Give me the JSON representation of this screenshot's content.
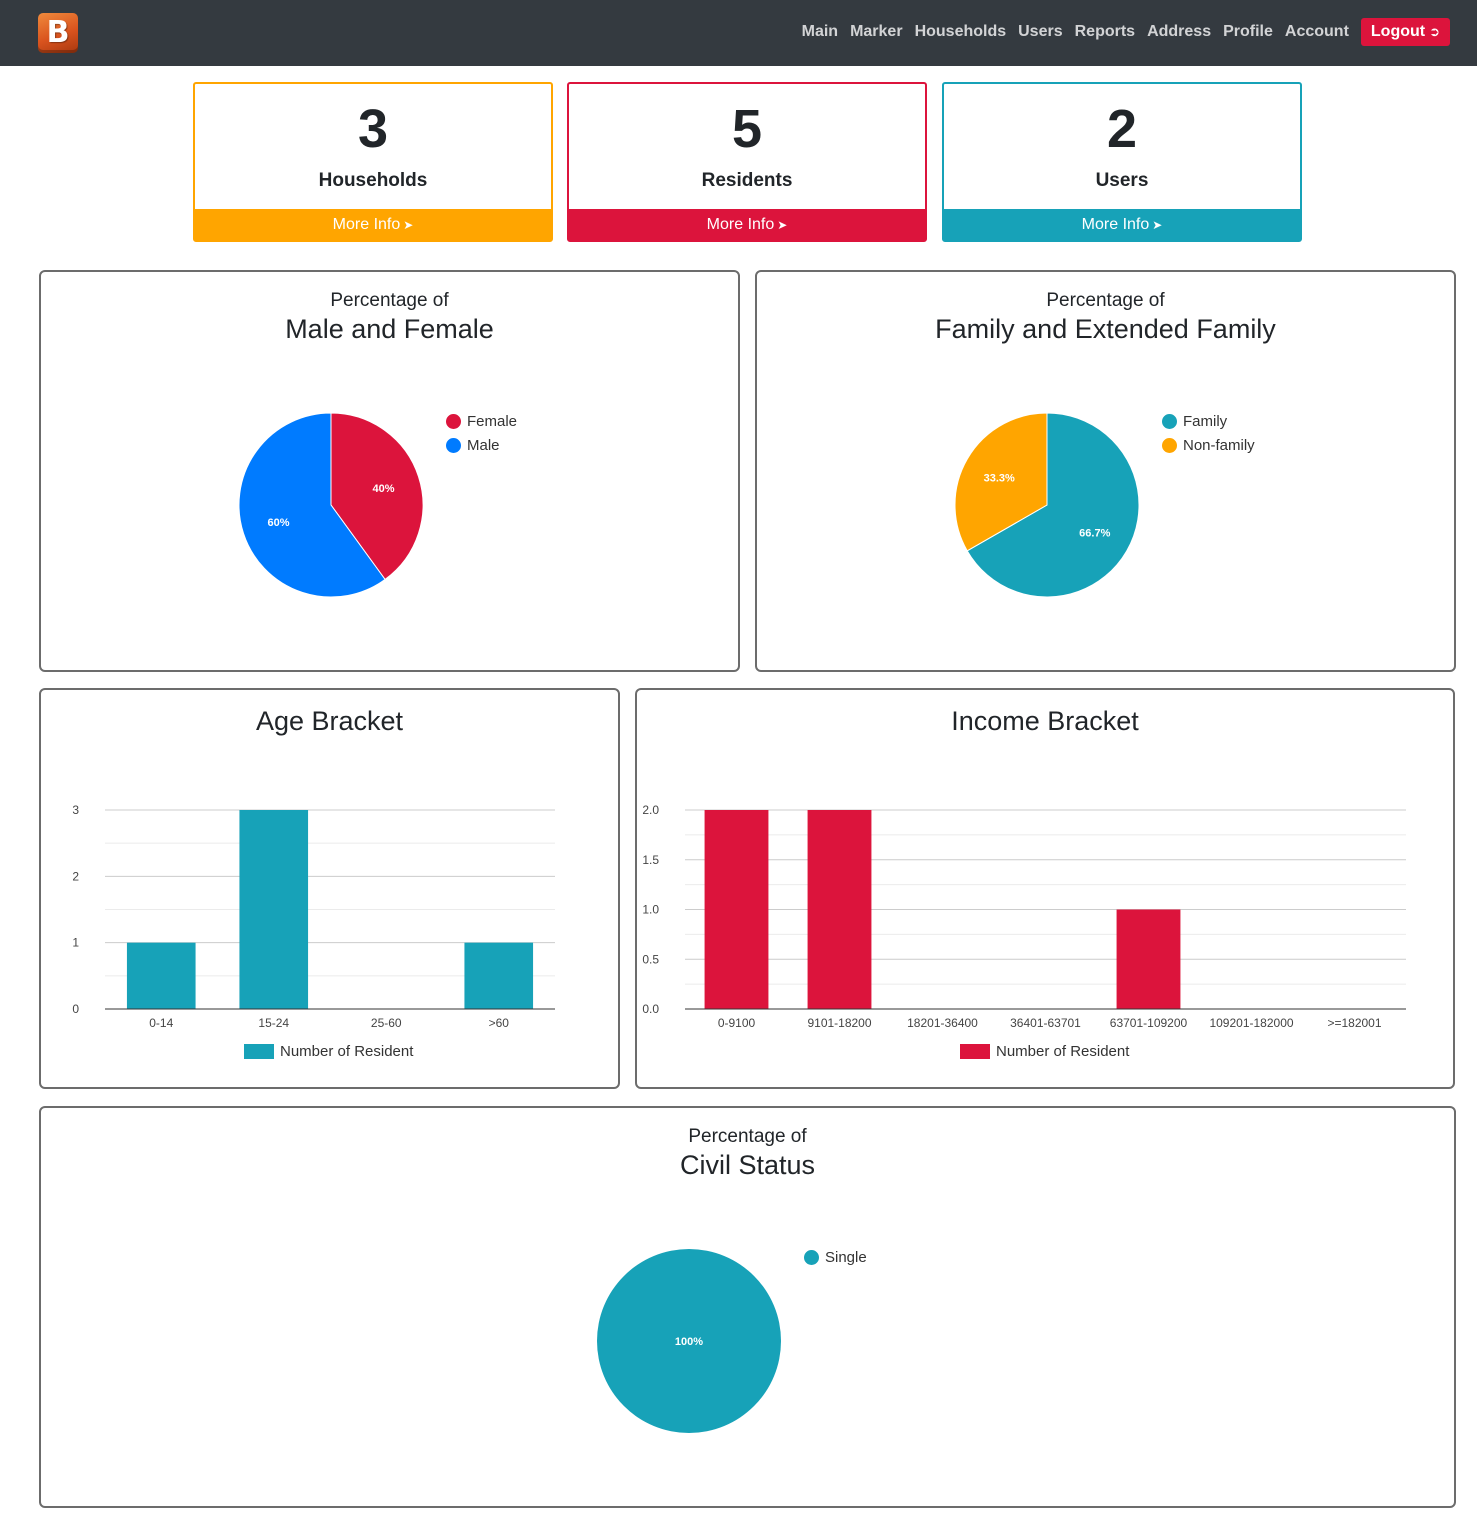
{
  "navbar": {
    "logo_letter": "B",
    "links": [
      "Main",
      "Marker",
      "Households",
      "Users",
      "Reports",
      "Address",
      "Profile",
      "Account"
    ],
    "logout_label": "Logout",
    "logout_icon": "sign-out-icon"
  },
  "stats": [
    {
      "value": "3",
      "label": "Households",
      "more": "More Info",
      "color": "#ffa500"
    },
    {
      "value": "5",
      "label": "Residents",
      "more": "More Info",
      "color": "#dc143c"
    },
    {
      "value": "2",
      "label": "Users",
      "more": "More Info",
      "color": "#17a2b8"
    }
  ],
  "more_info_icon": "sign-in-icon",
  "panels": {
    "gender": {
      "subtitle": "Percentage of",
      "title": "Male and Female"
    },
    "family": {
      "subtitle": "Percentage of",
      "title": "Family and Extended Family"
    },
    "age": {
      "title": "Age Bracket"
    },
    "income": {
      "title": "Income Bracket"
    },
    "civil": {
      "subtitle": "Percentage of",
      "title": "Civil Status"
    }
  },
  "chart_data": [
    {
      "type": "pie",
      "title": "Male and Female",
      "subtitle": "Percentage of",
      "labels": [
        "Female",
        "Male"
      ],
      "values": [
        40,
        60
      ],
      "value_labels": [
        "40%",
        "60%"
      ],
      "colors": [
        "#dc143c",
        "#007bff"
      ],
      "legend": "right"
    },
    {
      "type": "pie",
      "title": "Family and Extended Family",
      "subtitle": "Percentage of",
      "labels": [
        "Family",
        "Non-family"
      ],
      "values": [
        66.7,
        33.3
      ],
      "value_labels": [
        "66.7%",
        "33.3%"
      ],
      "colors": [
        "#17a2b8",
        "#ffa500"
      ],
      "legend": "right"
    },
    {
      "type": "bar",
      "title": "Age Bracket",
      "categories": [
        "0-14",
        "15-24",
        "25-60",
        ">60"
      ],
      "series": [
        {
          "name": "Number of Resident",
          "values": [
            1,
            3,
            0,
            1
          ],
          "color": "#17a2b8"
        }
      ],
      "yticks": [
        "0",
        "1",
        "2",
        "3"
      ],
      "ylim": [
        0,
        3
      ],
      "grid": true,
      "legend": "bottom"
    },
    {
      "type": "bar",
      "title": "Income Bracket",
      "categories": [
        "0-9100",
        "9101-18200",
        "18201-36400",
        "36401-63701",
        "63701-109200",
        "109201-182000",
        ">=182001"
      ],
      "series": [
        {
          "name": "Number of Resident",
          "values": [
            2,
            2,
            0,
            0,
            1,
            0,
            0
          ],
          "color": "#dc143c"
        }
      ],
      "yticks": [
        "0.0",
        "0.5",
        "1.0",
        "1.5",
        "2.0"
      ],
      "ylim": [
        0,
        2
      ],
      "grid": true,
      "legend": "bottom"
    },
    {
      "type": "pie",
      "title": "Civil Status",
      "subtitle": "Percentage of",
      "labels": [
        "Single"
      ],
      "values": [
        100
      ],
      "value_labels": [
        "100%"
      ],
      "colors": [
        "#17a2b8"
      ],
      "legend": "right"
    }
  ]
}
